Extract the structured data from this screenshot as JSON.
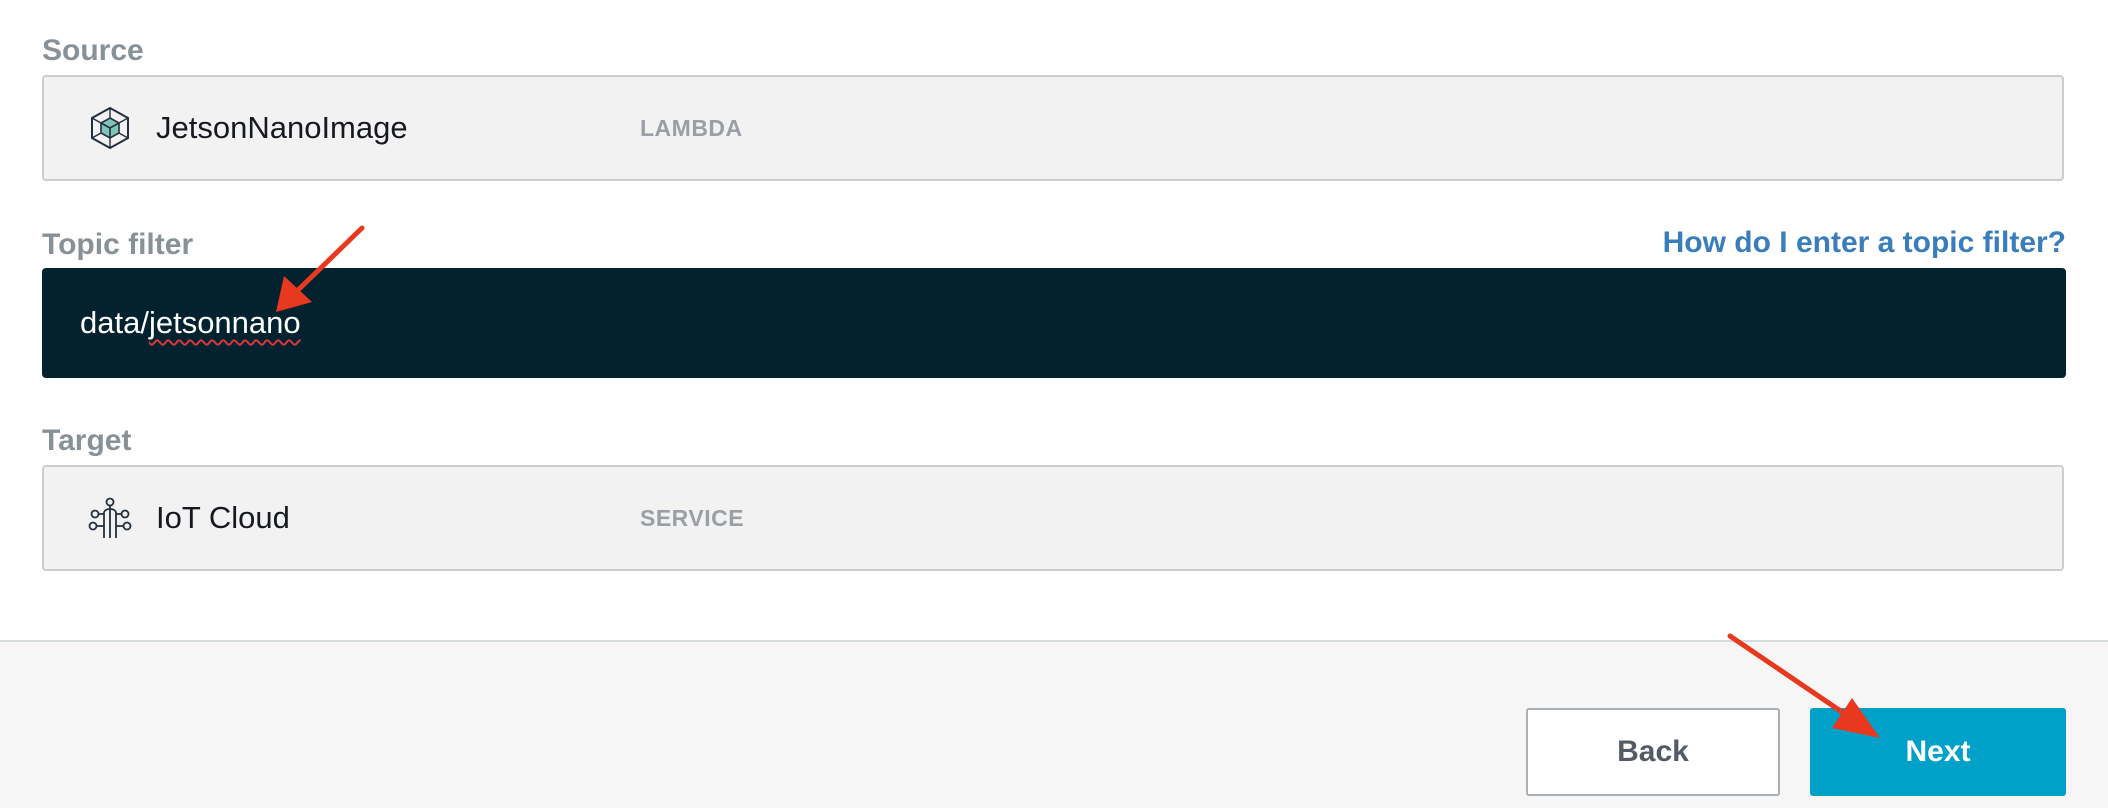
{
  "source": {
    "label": "Source",
    "name": "JetsonNanoImage",
    "type": "LAMBDA",
    "icon": "lambda-cube-icon"
  },
  "topic_filter": {
    "label": "Topic filter",
    "help_link": "How do I enter a topic filter?",
    "value_prefix": "data/",
    "value_misspelled": "jetsonnano",
    "value": "data/jetsonnano"
  },
  "target": {
    "label": "Target",
    "name": "IoT Cloud",
    "type": "SERVICE",
    "icon": "iot-cloud-icon"
  },
  "footer": {
    "back_label": "Back",
    "next_label": "Next"
  },
  "colors": {
    "accent": "#00a1c9",
    "link": "#3a7dbb",
    "input_bg": "#03222f",
    "annotation": "#e8381e"
  }
}
